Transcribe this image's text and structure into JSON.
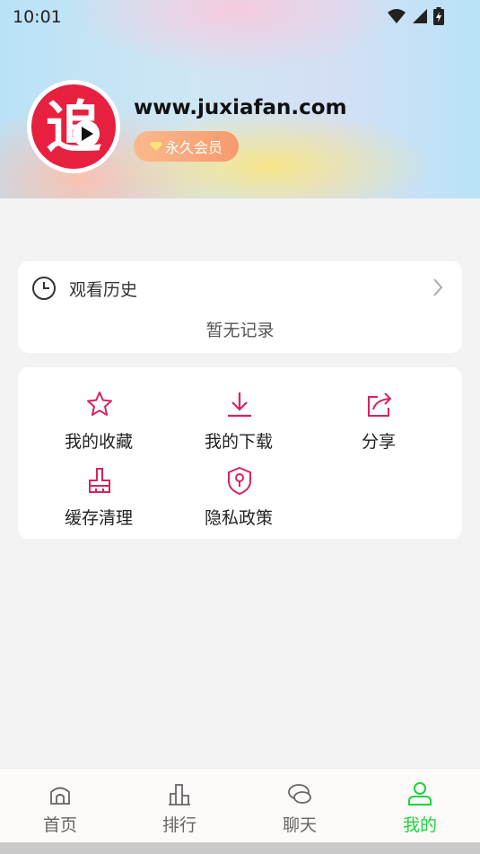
{
  "status_bar": {
    "time": "10:01"
  },
  "profile": {
    "site": "www.juxiafan.com",
    "badge": "永久会员",
    "logo_glyph": "追"
  },
  "history": {
    "title": "观看历史",
    "empty_text": "暂无记录"
  },
  "tools": [
    {
      "label": "我的收藏",
      "icon": "star-icon"
    },
    {
      "label": "我的下载",
      "icon": "download-icon"
    },
    {
      "label": "分享",
      "icon": "share-icon"
    },
    {
      "label": "缓存清理",
      "icon": "broom-icon"
    },
    {
      "label": "隐私政策",
      "icon": "shield-icon"
    }
  ],
  "tabbar": [
    {
      "label": "首页",
      "icon": "home-icon"
    },
    {
      "label": "排行",
      "icon": "ranking-icon"
    },
    {
      "label": "聊天",
      "icon": "chat-icon"
    },
    {
      "label": "我的",
      "icon": "user-icon",
      "active": true
    }
  ],
  "colors": {
    "accent": "#d6245c",
    "active_tab": "#1bd43e",
    "badge": "#f7a173"
  }
}
